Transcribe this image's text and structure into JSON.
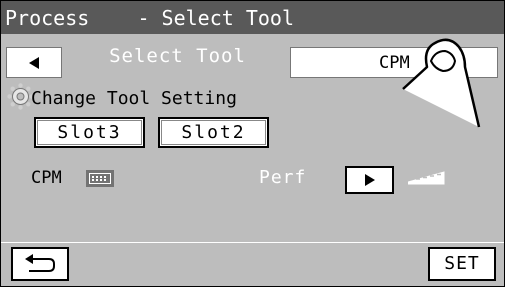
{
  "window": {
    "title": "Process    - Select Tool"
  },
  "tabs": [
    {
      "label": "Select Tool",
      "active": true
    },
    {
      "label": "CPM",
      "active": false
    }
  ],
  "section": {
    "title": "Change Tool Setting"
  },
  "slots": [
    {
      "label": "Slot3"
    },
    {
      "label": "Slot2"
    }
  ],
  "cpm": {
    "label": "CPM"
  },
  "perf": {
    "label": "Perf"
  },
  "footer": {
    "set_label": "SET"
  },
  "icons": {
    "tab_prev": "triangle-left-icon",
    "settings": "gear-icon",
    "cpm": "cpm-mark-icon",
    "perf_go": "triangle-right-icon",
    "perf": "perforation-icon",
    "back": "return-arrow-icon",
    "finger": "pointing-finger-icon"
  },
  "colors": {
    "background": "#bdbdbd",
    "titlebar": "#595959",
    "button": "#ffffff",
    "text": "#000000",
    "active_tab_text": "#ffffff"
  }
}
